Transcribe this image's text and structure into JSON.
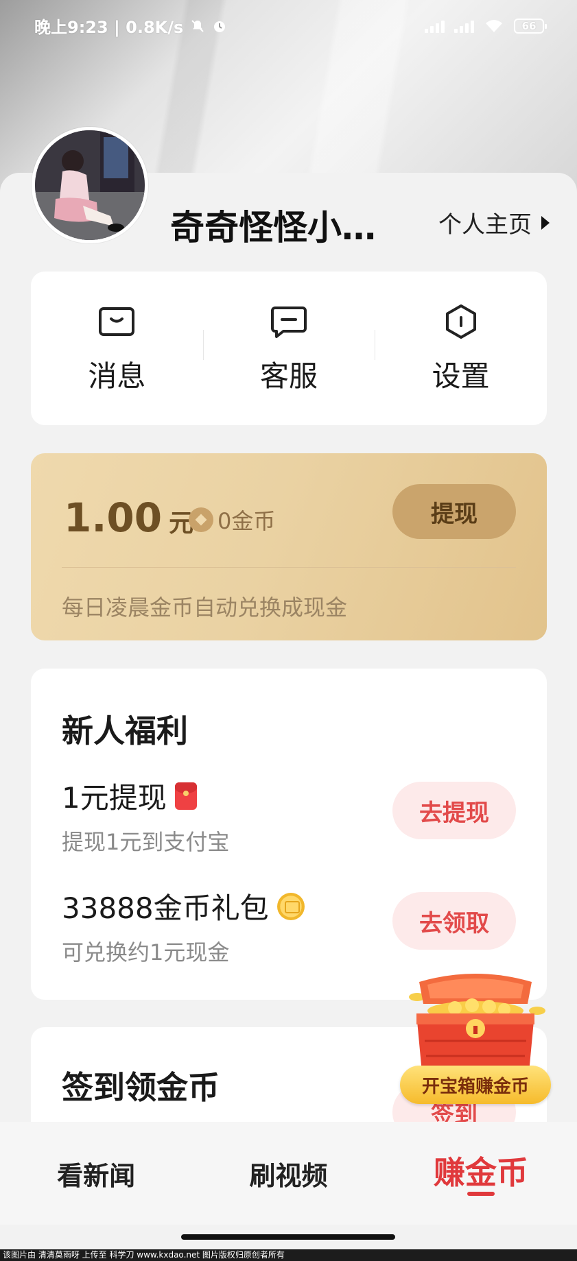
{
  "status_bar": {
    "time": "晚上9:23 | 0.8K/s",
    "battery": "66"
  },
  "profile": {
    "username": "奇奇怪怪小…",
    "homepage_link": "个人主页"
  },
  "menu": {
    "items": [
      {
        "label": "消息",
        "icon": "message-icon"
      },
      {
        "label": "客服",
        "icon": "customer-service-icon"
      },
      {
        "label": "设置",
        "icon": "settings-icon"
      }
    ]
  },
  "wallet": {
    "amount": "1.00",
    "amount_unit": "元",
    "coins": "0金币",
    "withdraw_label": "提现",
    "note": "每日凌晨金币自动兑换成现金"
  },
  "benefits": {
    "title": "新人福利",
    "items": [
      {
        "title": "1元提现",
        "subtitle": "提现1元到支付宝",
        "button": "去提现"
      },
      {
        "title": "33888金币礼包",
        "subtitle": "可兑换约1元现金",
        "button": "去领取"
      }
    ]
  },
  "signin": {
    "title": "签到领金币",
    "button": "签到"
  },
  "chest": {
    "label": "开宝箱赚金币"
  },
  "tabbar": {
    "tabs": [
      {
        "label": "看新闻"
      },
      {
        "label": "刷视频"
      },
      {
        "label": "赚金币"
      }
    ],
    "active_index": 2
  },
  "watermark": "该图片由 清清莫雨呀 上传至 科学刀 www.kxdao.net 图片版权归原创者所有",
  "colors": {
    "accent_red": "#e0393c",
    "wallet_gold": "#ead2a3"
  }
}
